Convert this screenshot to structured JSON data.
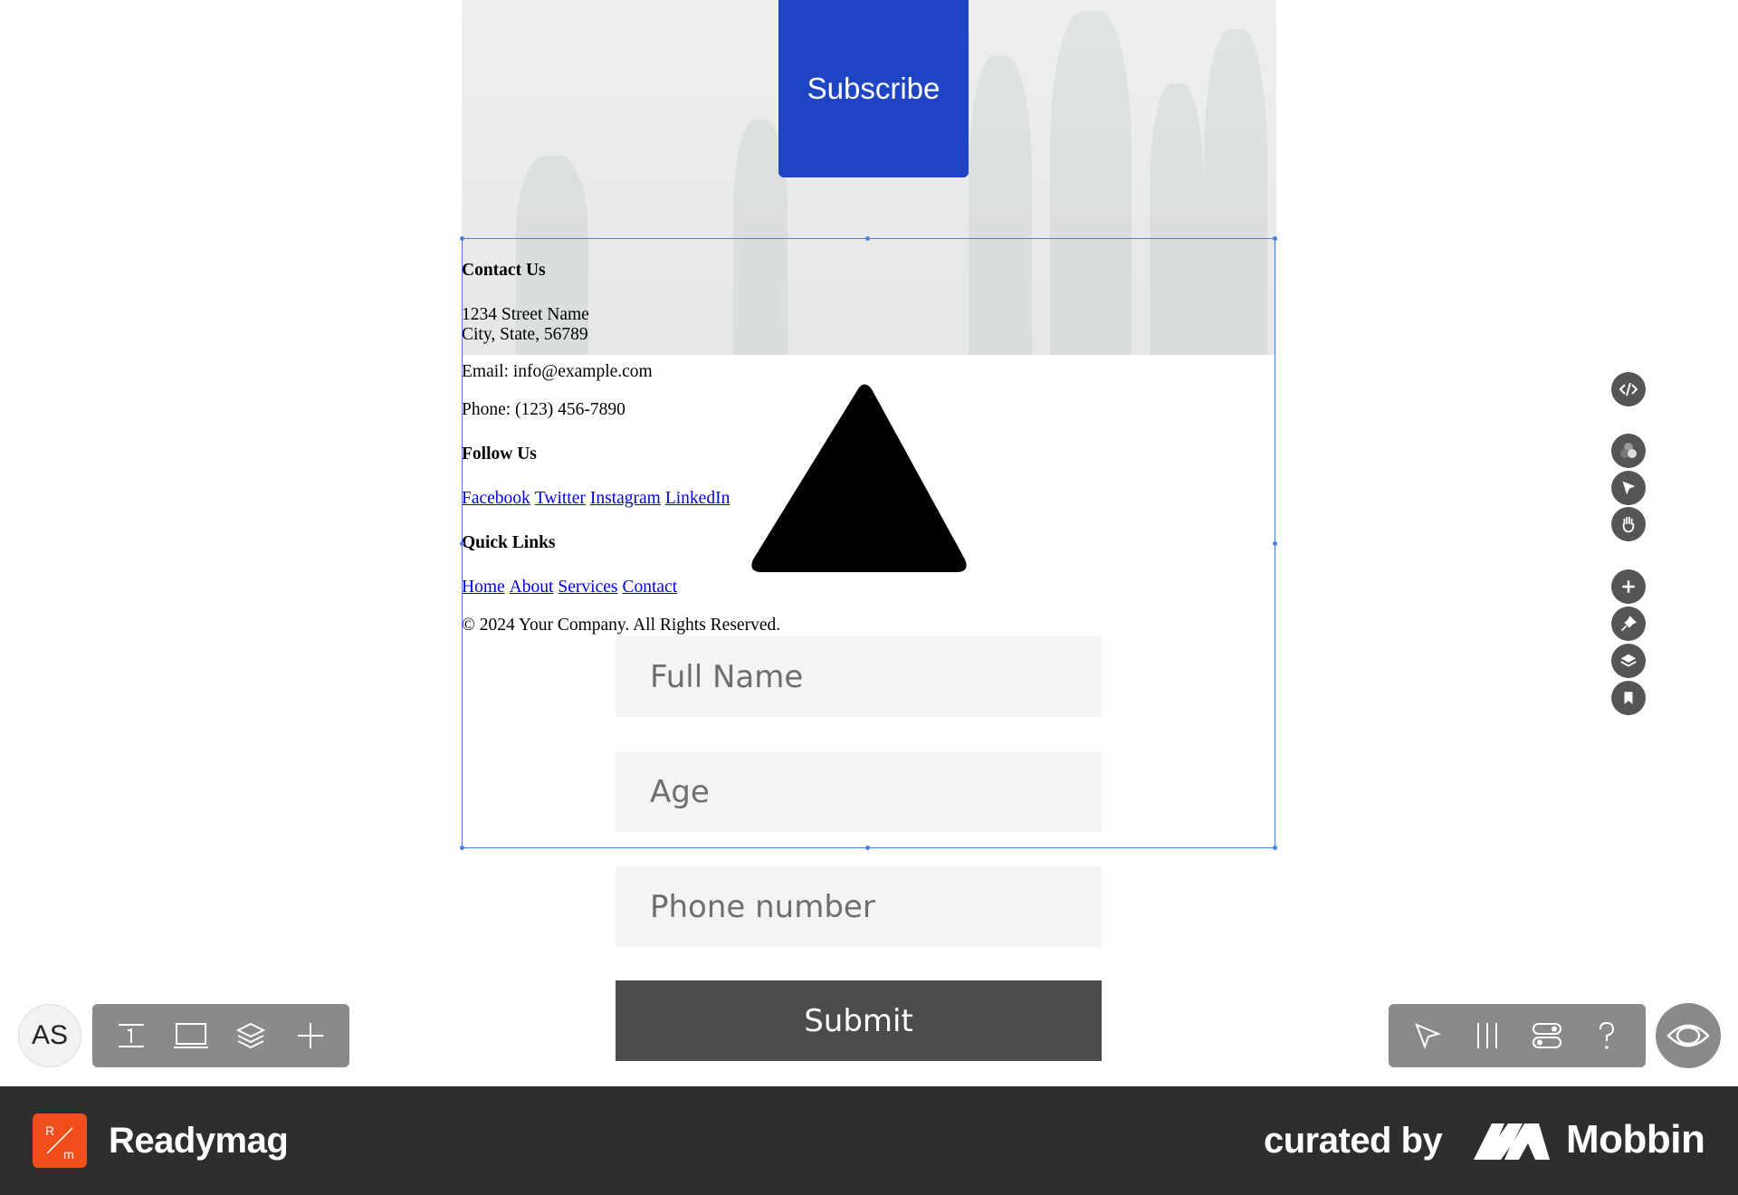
{
  "hero": {
    "subscribe_label": "Subscribe",
    "subscribe_color": "#1f45c4"
  },
  "footer": {
    "contact_heading": "Contact Us",
    "address_line1": "1234 Street Name",
    "address_line2": "City, State, 56789",
    "email": "Email: info@example.com",
    "phone": "Phone: (123) 456-7890",
    "follow_heading": "Follow Us",
    "social_links": [
      "Facebook",
      "Twitter",
      "Instagram",
      "LinkedIn"
    ],
    "quick_heading": "Quick Links",
    "quick_links": [
      "Home",
      "About",
      "Services",
      "Contact"
    ],
    "copyright": "© 2024 Your Company. All Rights Reserved."
  },
  "form": {
    "full_name_placeholder": "Full Name",
    "age_placeholder": "Age",
    "phone_placeholder": "Phone number",
    "submit_label": "Submit"
  },
  "right_tools": [
    "code-icon",
    "colors-icon",
    "pointer-icon",
    "hand-icon",
    "add-icon",
    "pin-icon",
    "layers-icon",
    "bookmark-icon"
  ],
  "toolbar": {
    "avatar_initials": "AS",
    "left_icons": [
      "text-icon",
      "screen-icon",
      "layers-icon",
      "add-icon"
    ],
    "right_icons": [
      "pointer-icon",
      "columns-icon",
      "toggle-icon",
      "help-icon"
    ],
    "preview_icon": "eye-icon"
  },
  "branding": {
    "app_name": "Readymag",
    "logo_letters_top": "R",
    "logo_letters_bottom": "m",
    "curated_label": "curated by",
    "curator_name": "Mobbin",
    "logo_color": "#f04e1a",
    "bar_color": "#2e2e2e"
  }
}
